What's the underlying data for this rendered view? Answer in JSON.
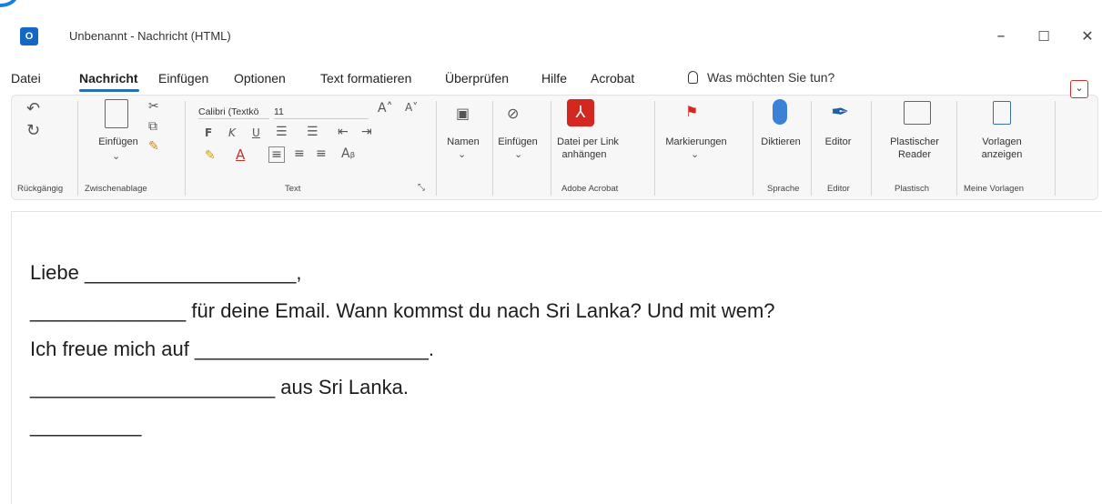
{
  "window": {
    "app_icon": "O",
    "title": "Unbenannt - Nachricht (HTML)",
    "minimize": "–",
    "maximize": "☐",
    "close": "✕"
  },
  "menu": {
    "items": [
      "Datei",
      "Nachricht",
      "Einfügen",
      "Optionen",
      "Text formatieren",
      "Überprüfen",
      "Hilfe",
      "Acrobat"
    ],
    "active": "Nachricht",
    "search": "Was möchten Sie tun?"
  },
  "ribbon": {
    "undo_group": "Rückgängig",
    "clipboard": {
      "paste_label": "Einfügen",
      "group": "Zwischenablage"
    },
    "text": {
      "font": "Calibri (Textkö",
      "size": "11",
      "bold": "F",
      "italic": "K",
      "underline": "U",
      "group": "Text"
    },
    "names": {
      "label": "Namen"
    },
    "insert": {
      "label": "Einfügen"
    },
    "adobe": {
      "label1": "Datei per Link",
      "label2": "anhängen",
      "group": "Adobe Acrobat"
    },
    "flags": {
      "label": "Markierungen"
    },
    "speech": {
      "label": "Diktieren",
      "group": "Sprache"
    },
    "editor": {
      "label": "Editor",
      "group": "Editor"
    },
    "immersive": {
      "label1": "Plastischer",
      "label2": "Reader",
      "group": "Plastisch"
    },
    "templates": {
      "label1": "Vorlagen",
      "label2": "anzeigen",
      "group": "Meine Vorlagen"
    },
    "collapse_icon": "chevron-down-icon"
  },
  "message": {
    "lines": [
      "Liebe ___________________,",
      "______________ für deine Email. Wann kommst du nach Sri Lanka? Und mit wem?",
      "Ich freue mich auf _____________________.",
      "______________________ aus Sri Lanka.",
      "__________"
    ]
  }
}
